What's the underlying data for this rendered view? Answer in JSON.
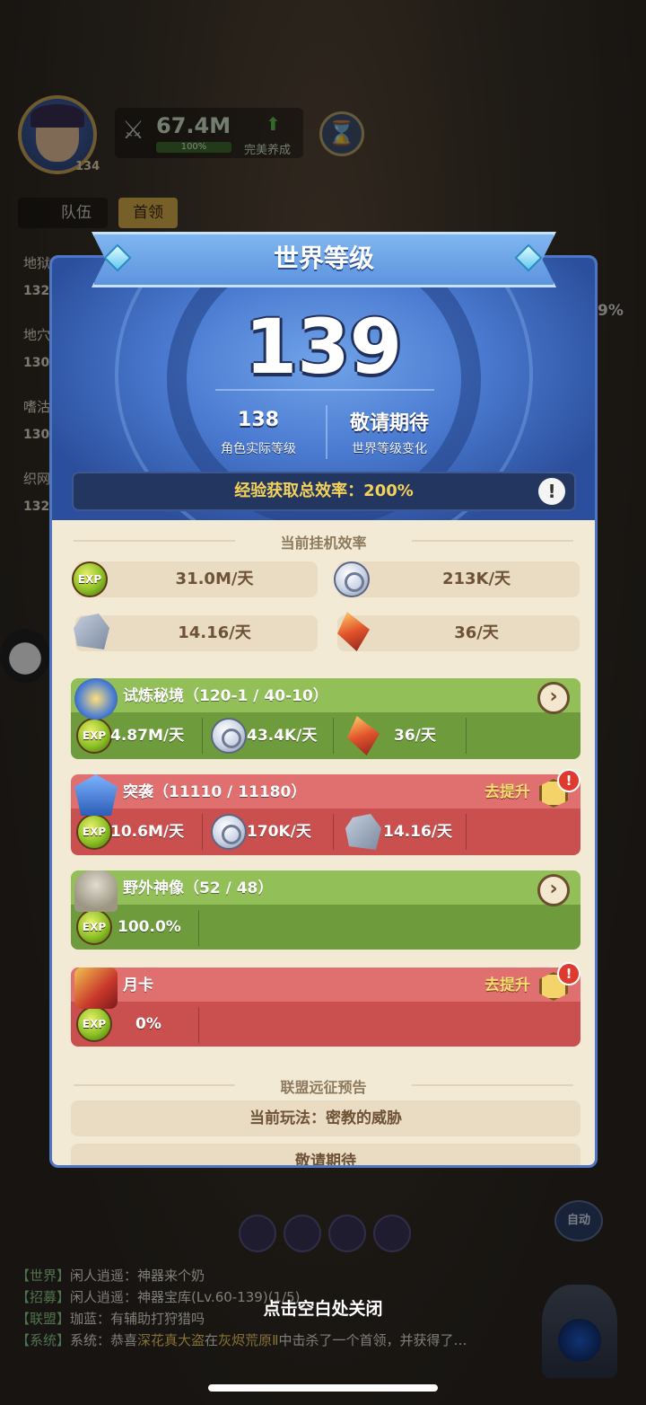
{
  "hud": {
    "avatar_level": "134",
    "power": "67.4M",
    "power_percent": "100%",
    "perfect_label": "完美养成",
    "tabs": [
      "队伍",
      "首领"
    ],
    "side_labels": [
      "地狱",
      "地穴",
      "嗜沽",
      "织网"
    ],
    "side_levels": [
      "132",
      "130",
      "130",
      "132"
    ],
    "right_percent": "9%",
    "auto_label": "自动"
  },
  "modal": {
    "title": "世界等级",
    "world_level": "139",
    "actual_level_value": "138",
    "actual_level_label": "角色实际等级",
    "change_value": "敬请期待",
    "change_label": "世界等级变化",
    "efficiency_text": "经验获取总效率：200%",
    "info_icon": "!",
    "idle_title": "当前挂机效率",
    "idle_rates": [
      {
        "icon": "exp-icon",
        "value": "31.0M/天"
      },
      {
        "icon": "coin-icon",
        "value": "213K/天"
      },
      {
        "icon": "stone-icon",
        "value": "14.16/天"
      },
      {
        "icon": "crystal-icon",
        "value": "36/天"
      }
    ],
    "modes": [
      {
        "name": "试炼秘境（120-1 / 40-10）",
        "theme": "green",
        "action": "go",
        "cells": [
          "4.87M/天",
          "43.4K/天",
          "36/天"
        ]
      },
      {
        "name": "突袭（11110 / 11180）",
        "theme": "red",
        "action": "去提升",
        "cells": [
          "10.6M/天",
          "170K/天",
          "14.16/天"
        ]
      },
      {
        "name": "野外神像（52 / 48）",
        "theme": "green",
        "action": "go",
        "cells": [
          "100.0%"
        ]
      },
      {
        "name": "月卡",
        "theme": "red",
        "action": "去提升",
        "cells": [
          "0%"
        ]
      }
    ],
    "alliance_title": "联盟远征预告",
    "alliance_current": "当前玩法：密教的威胁",
    "alliance_next": "敬请期待"
  },
  "chat": [
    {
      "tag": "【世界】",
      "text": "闲人逍遥：神器来个奶"
    },
    {
      "tag": "【招募】",
      "text": "闲人逍遥：神器宝库(Lv.60-139)(1/5)"
    },
    {
      "tag": "【联盟】",
      "text": "珈蓝：有辅助打狩猎吗"
    },
    {
      "tag": "【系统】",
      "text": "系统：恭喜",
      "highlight": "深花真大盗",
      "text2": "在",
      "highlight2": "灰烬荒原Ⅱ",
      "text3": "中击杀了一个首领，并获得了…"
    }
  ],
  "close_hint": "点击空白处关闭"
}
